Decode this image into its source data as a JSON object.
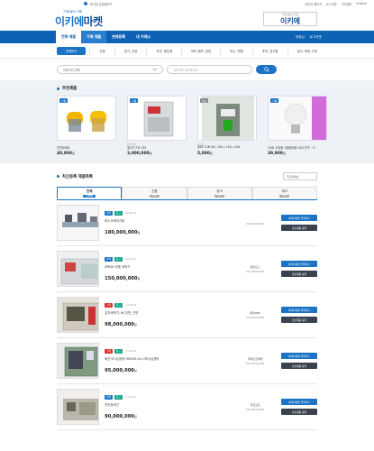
{
  "topbar": {
    "left_text": "대기업 분류별보기",
    "links": [
      "관리자 페이지",
      "로그아웃",
      "고객센터",
      "English"
    ]
  },
  "header": {
    "logo_sub": "기계/설비 거래",
    "logo_main_a": "이키에",
    "logo_main_b": "마켓",
    "right_sub": "기계/설비 전문",
    "right_main": "이키에"
  },
  "nav": {
    "tabs": [
      "전체 제품",
      "구매 제품",
      "판매등록",
      "내 거래소"
    ],
    "right": [
      "대표님",
      "로그아웃"
    ]
  },
  "categories": [
    "전체보기",
    "차종",
    "공기, 진공",
    "자전, 응답계",
    "모터 펌프, 공압",
    "지수, 변형",
    "조작, 검사용",
    "검사, 측정 기계"
  ],
  "search": {
    "select_label": "카테고리 선택",
    "placeholder": "검색어를 입력하세요"
  },
  "recommended": {
    "title": "추천제품",
    "items": [
      {
        "badge": "신품",
        "meta": "",
        "name": "안전모세트",
        "price": "40,000",
        "unit": "원"
      },
      {
        "badge": "신품",
        "meta": "산업기계",
        "name": "절삭기 TD 155",
        "price": "3,000,000",
        "unit": "원"
      },
      {
        "badge": "재고",
        "meta": "차단기",
        "name": "DBE 32B 5A / 10A / 15A / 20A",
        "price": "5,000",
        "unit": "원"
      },
      {
        "badge": "신품",
        "meta": "",
        "name": "15W 고효율 식물생장용 LED 전구 - P...",
        "price": "29,900",
        "unit": "원"
      }
    ]
  },
  "latest": {
    "title": "최신등록 제품목록",
    "sort_label": "최신등록순",
    "tabs": [
      {
        "label": "전체",
        "count": "1,000"
      },
      {
        "label": "신품",
        "count": "234"
      },
      {
        "label": "중고",
        "count": "577"
      },
      {
        "label": "재고",
        "count": "189"
      }
    ],
    "rows": [
      {
        "tag1": "판매",
        "tag2": "중고",
        "tag1_color": "blue",
        "date": "22.08.09",
        "name": "파스크제어기계",
        "price": "180,000,000",
        "unit": "원",
        "seller": "",
        "phone": "010-0000-0000"
      },
      {
        "tag1": "판매",
        "tag2": "중고",
        "tag1_color": "blue",
        "date": "19.03.12",
        "name": "SPRAY 부품 세척기",
        "price": "150,000,000",
        "unit": "원",
        "seller": "글린도스",
        "phone": "010-0000-0000"
      },
      {
        "tag1": "구매",
        "tag2": "중고",
        "tag1_color": "red",
        "date": "17.03.04",
        "name": "입자세척기, NC선반, 선반",
        "price": "98,000,000",
        "unit": "원",
        "seller": "재민KMC",
        "phone": "010-0000-0000"
      },
      {
        "tag1": "구매",
        "tag2": "중고",
        "tag1_color": "red",
        "date": "17.08.26",
        "name": "화선 머시닝센터 SIRIUS-UL+/머시닝센터",
        "price": "95,000,000",
        "unit": "원",
        "seller": "우라큰코퍼레",
        "phone": "010-0000-0000"
      },
      {
        "tag1": "판매",
        "tag2": "중고",
        "tag1_color": "blue",
        "date": "17.05.21",
        "name": "연속장비선",
        "price": "90,000,000",
        "unit": "원",
        "seller": "우진오토",
        "phone": "010-0000-0000"
      }
    ],
    "btn_contact": "판매자에게 연락하기",
    "btn_interest": "관심제품 등록"
  }
}
